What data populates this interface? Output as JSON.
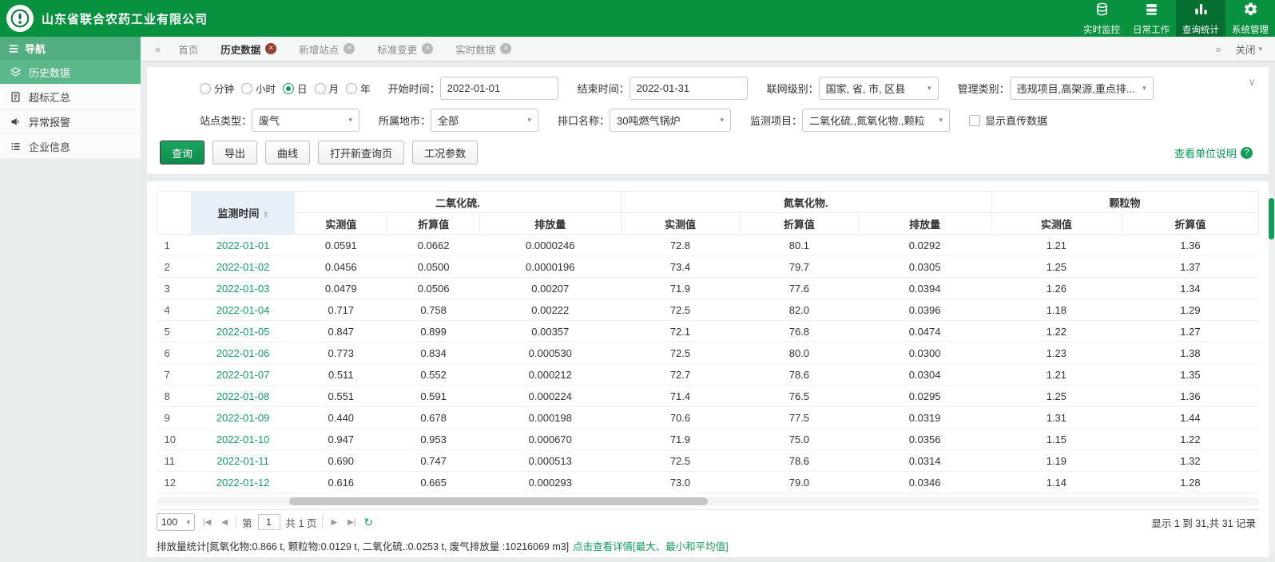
{
  "colors": {
    "brand_green": "#08913f",
    "accent_green": "#0f9d5a"
  },
  "header": {
    "company": "山东省联合农药工业有限公司",
    "nav": [
      {
        "label": "实时监控"
      },
      {
        "label": "日常工作"
      },
      {
        "label": "查询统计"
      },
      {
        "label": "系统管理"
      }
    ]
  },
  "sidebar": {
    "title": "导航",
    "items": [
      {
        "label": "历史数据"
      },
      {
        "label": "超标汇总"
      },
      {
        "label": "异常报警"
      },
      {
        "label": "企业信息"
      }
    ]
  },
  "tabbar": {
    "tabs": [
      {
        "label": "首页"
      },
      {
        "label": "历史数据"
      },
      {
        "label": "新增站点"
      },
      {
        "label": "标准变更"
      },
      {
        "label": "实时数据"
      }
    ],
    "close_label": "关闭"
  },
  "filters": {
    "periods": [
      "分钟",
      "小时",
      "日",
      "月",
      "年"
    ],
    "selected_period": "日",
    "start_time": {
      "label": "开始时间：",
      "value": "2022-01-01"
    },
    "end_time": {
      "label": "结束时间：",
      "value": "2022-01-31"
    },
    "network_level": {
      "label": "联网级别：",
      "value": "国家, 省, 市, 区县"
    },
    "manage_type": {
      "label": "管理类别：",
      "value": "违规项目,高架源,重点排..."
    },
    "site_type": {
      "label": "站点类型：",
      "value": "废气"
    },
    "city": {
      "label": "所属地市：",
      "value": "全部"
    },
    "outlet": {
      "label": "排口名称：",
      "value": "30吨燃气锅炉"
    },
    "monitor_items": {
      "label": "监测项目：",
      "value": "二氧化硫.,氮氧化物.,颗粒"
    },
    "direct_data_checkbox": "显示直传数据",
    "buttons": {
      "query": "查询",
      "export": "导出",
      "curve": "曲线",
      "new_query": "打开新查询页",
      "condition": "工况参数"
    },
    "unit_link": "查看单位说明",
    "unit_help": "?"
  },
  "table": {
    "time_header": "监测时间",
    "groups": [
      {
        "label": "二氧化硫.",
        "cols": [
          "实测值",
          "折算值",
          "排放量"
        ]
      },
      {
        "label": "氮氧化物.",
        "cols": [
          "实测值",
          "折算值",
          "排放量"
        ]
      },
      {
        "label": "颗粒物",
        "cols": [
          "实测值",
          "折算值"
        ]
      }
    ],
    "rows": [
      {
        "no": "1",
        "date": "2022-01-01",
        "values": [
          "0.0591",
          "0.0662",
          "0.0000246",
          "72.8",
          "80.1",
          "0.0292",
          "1.21",
          "1.36"
        ]
      },
      {
        "no": "2",
        "date": "2022-01-02",
        "values": [
          "0.0456",
          "0.0500",
          "0.0000196",
          "73.4",
          "79.7",
          "0.0305",
          "1.25",
          "1.37"
        ]
      },
      {
        "no": "3",
        "date": "2022-01-03",
        "values": [
          "0.0479",
          "0.0506",
          "0.00207",
          "71.9",
          "77.6",
          "0.0394",
          "1.26",
          "1.34"
        ]
      },
      {
        "no": "4",
        "date": "2022-01-04",
        "values": [
          "0.717",
          "0.758",
          "0.00222",
          "72.5",
          "82.0",
          "0.0396",
          "1.18",
          "1.29"
        ]
      },
      {
        "no": "5",
        "date": "2022-01-05",
        "values": [
          "0.847",
          "0.899",
          "0.00357",
          "72.1",
          "76.8",
          "0.0474",
          "1.22",
          "1.27"
        ]
      },
      {
        "no": "6",
        "date": "2022-01-06",
        "values": [
          "0.773",
          "0.834",
          "0.000530",
          "72.5",
          "80.0",
          "0.0300",
          "1.23",
          "1.38"
        ]
      },
      {
        "no": "7",
        "date": "2022-01-07",
        "values": [
          "0.511",
          "0.552",
          "0.000212",
          "72.7",
          "78.6",
          "0.0304",
          "1.21",
          "1.35"
        ]
      },
      {
        "no": "8",
        "date": "2022-01-08",
        "values": [
          "0.551",
          "0.591",
          "0.000224",
          "71.4",
          "76.5",
          "0.0295",
          "1.25",
          "1.36"
        ]
      },
      {
        "no": "9",
        "date": "2022-01-09",
        "values": [
          "0.440",
          "0.678",
          "0.000198",
          "70.6",
          "77.5",
          "0.0319",
          "1.31",
          "1.44"
        ]
      },
      {
        "no": "10",
        "date": "2022-01-10",
        "values": [
          "0.947",
          "0.953",
          "0.000670",
          "71.9",
          "75.0",
          "0.0356",
          "1.15",
          "1.22"
        ]
      },
      {
        "no": "11",
        "date": "2022-01-11",
        "values": [
          "0.690",
          "0.747",
          "0.000513",
          "72.5",
          "78.6",
          "0.0314",
          "1.19",
          "1.32"
        ]
      },
      {
        "no": "12",
        "date": "2022-01-12",
        "values": [
          "0.616",
          "0.665",
          "0.000293",
          "73.0",
          "79.0",
          "0.0346",
          "1.14",
          "1.28"
        ]
      }
    ]
  },
  "pagination": {
    "page_size": "100",
    "page_text_prefix": "第",
    "current_page": "1",
    "page_text_suffix": "共 1 页",
    "records_summary": "显示 1 到 31,共 31 记录"
  },
  "status_bar": {
    "stats": "排放量统计[氮氧化物:0.866 t, 颗粒物:0.0129 t, 二氧化硫.:0.0253 t, 废气排放量 :10216069 m3]",
    "detail_link": "点击查看详情[最大、最小和平均值]"
  }
}
